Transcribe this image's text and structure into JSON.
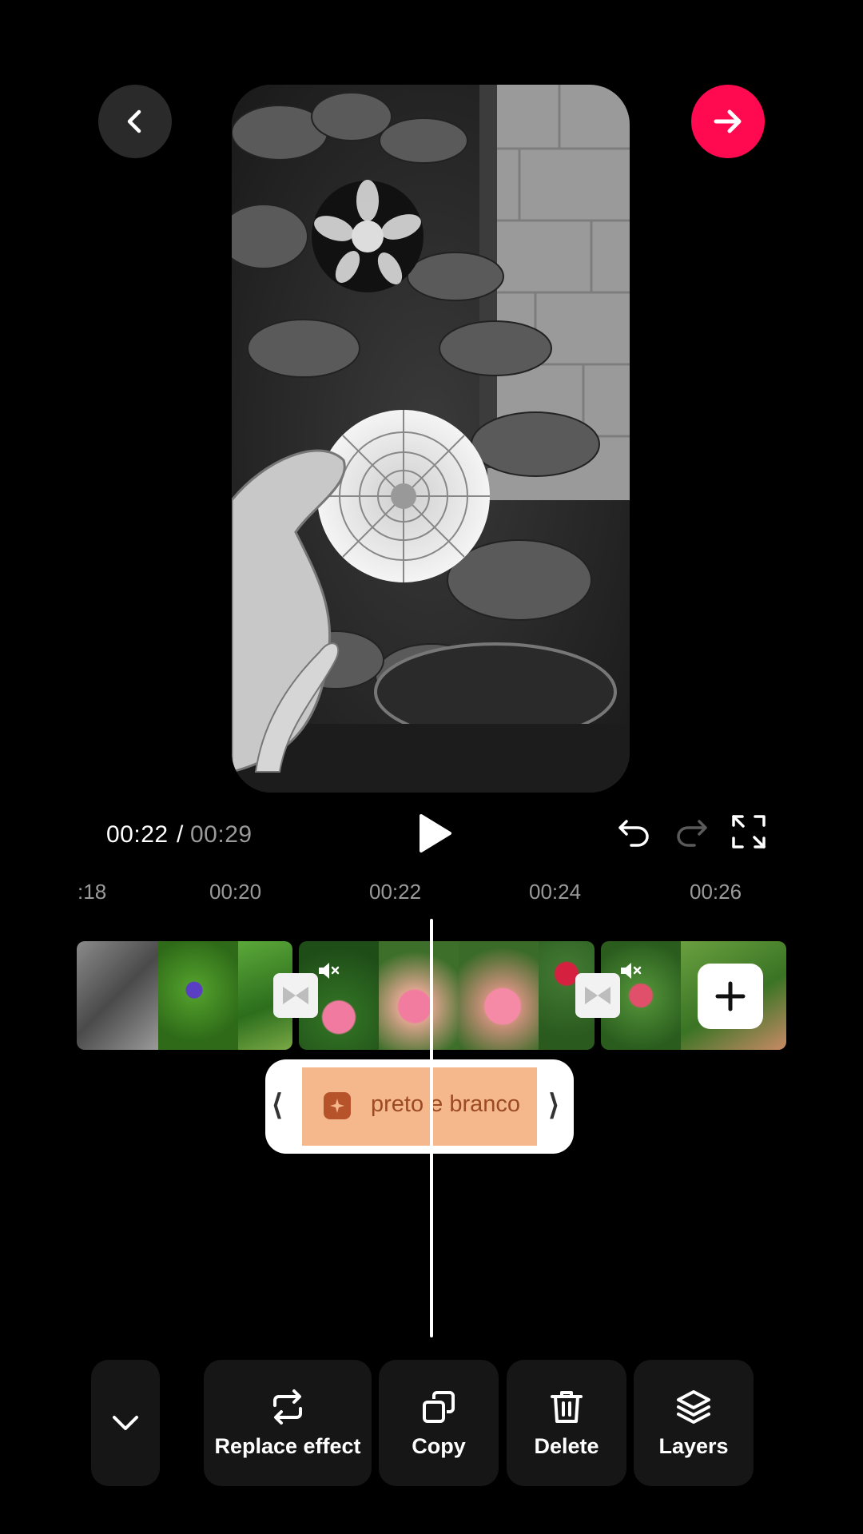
{
  "colors": {
    "accent": "#ff0a50",
    "effect_fill": "#f5b88d",
    "effect_text": "#9c4a22"
  },
  "playback": {
    "current_time": "00:22",
    "separator": "/",
    "total_time": "00:29"
  },
  "ruler": [
    "18",
    "00:20",
    "00:22",
    "00:24",
    "00:26"
  ],
  "effect": {
    "label": "preto e branco",
    "icon": "sparkle-icon"
  },
  "toolbar": {
    "items": [
      {
        "label": "Replace effect",
        "icon": "replace-icon"
      },
      {
        "label": "Copy",
        "icon": "copy-icon"
      },
      {
        "label": "Delete",
        "icon": "trash-icon"
      },
      {
        "label": "Layers",
        "icon": "layers-icon"
      }
    ]
  }
}
